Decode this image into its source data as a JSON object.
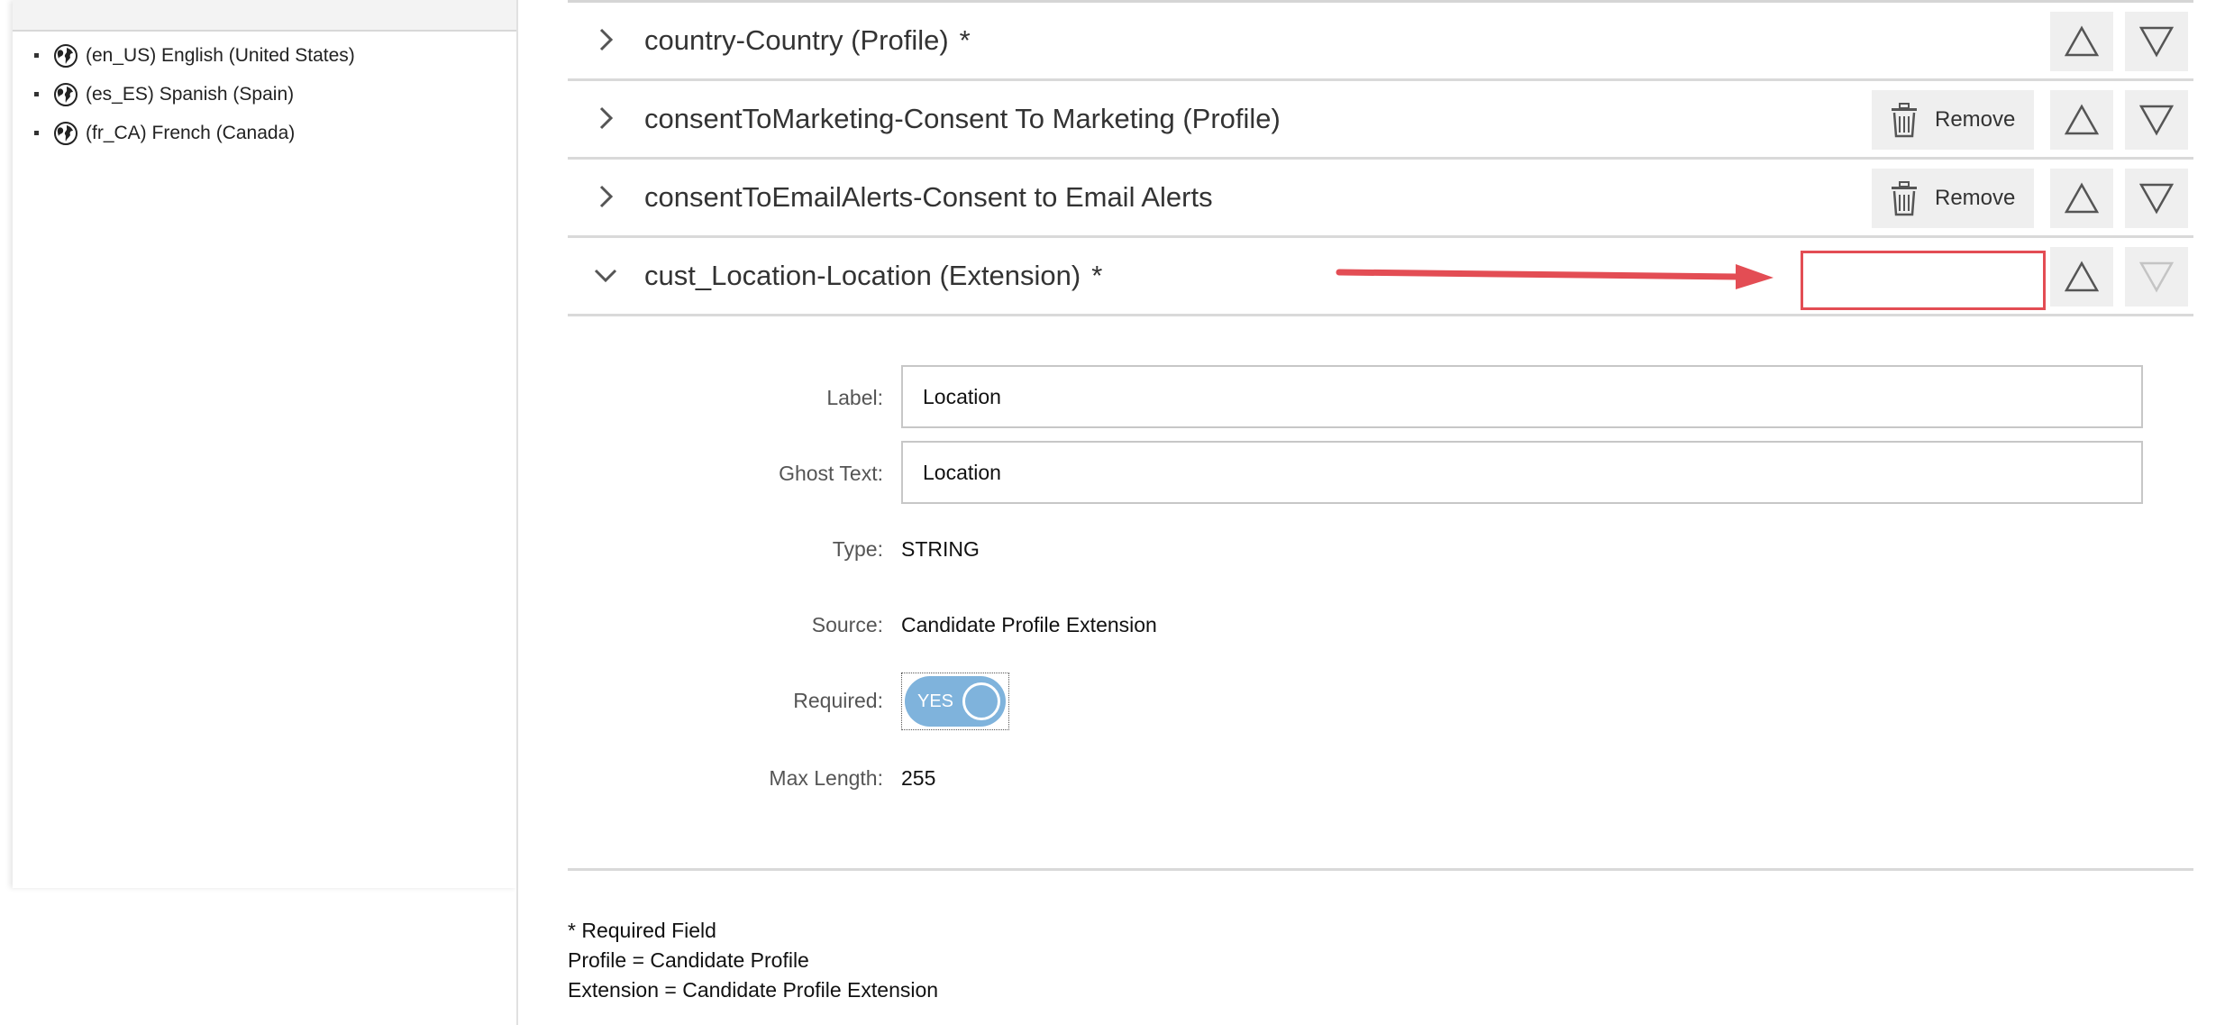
{
  "sidebar": {
    "languages": [
      {
        "label": "(en_US) English (United States)",
        "icon": "globe-icon"
      },
      {
        "label": "(es_ES) Spanish (Spain)",
        "icon": "globe-icon"
      },
      {
        "label": "(fr_CA) French (Canada)",
        "icon": "globe-icon"
      }
    ]
  },
  "fields": [
    {
      "title": "country-Country (Profile)",
      "required_mark": "*",
      "expanded": false,
      "has_remove": false
    },
    {
      "title": "consentToMarketing-Consent To Marketing (Profile)",
      "required_mark": "",
      "expanded": false,
      "has_remove": true
    },
    {
      "title": "consentToEmailAlerts-Consent to Email Alerts",
      "required_mark": "",
      "expanded": false,
      "has_remove": true
    },
    {
      "title": "cust_Location-Location (Extension)",
      "required_mark": "*",
      "expanded": true,
      "has_remove": false
    }
  ],
  "remove_label": "Remove",
  "detail": {
    "label_caption": "Label:",
    "label_value": "Location",
    "ghost_caption": "Ghost Text:",
    "ghost_value": "Location",
    "type_caption": "Type:",
    "type_value": "STRING",
    "source_caption": "Source:",
    "source_value": "Candidate Profile Extension",
    "required_caption": "Required:",
    "required_toggle": "YES",
    "maxlength_caption": "Max Length:",
    "maxlength_value": "255"
  },
  "legend": {
    "line1": "* Required Field",
    "line2": "Profile = Candidate Profile",
    "line3": "Extension = Candidate Profile Extension"
  },
  "colors": {
    "annotation_red": "#e34d54",
    "toggle_blue": "#7fb3dc",
    "button_gray": "#efefef"
  }
}
